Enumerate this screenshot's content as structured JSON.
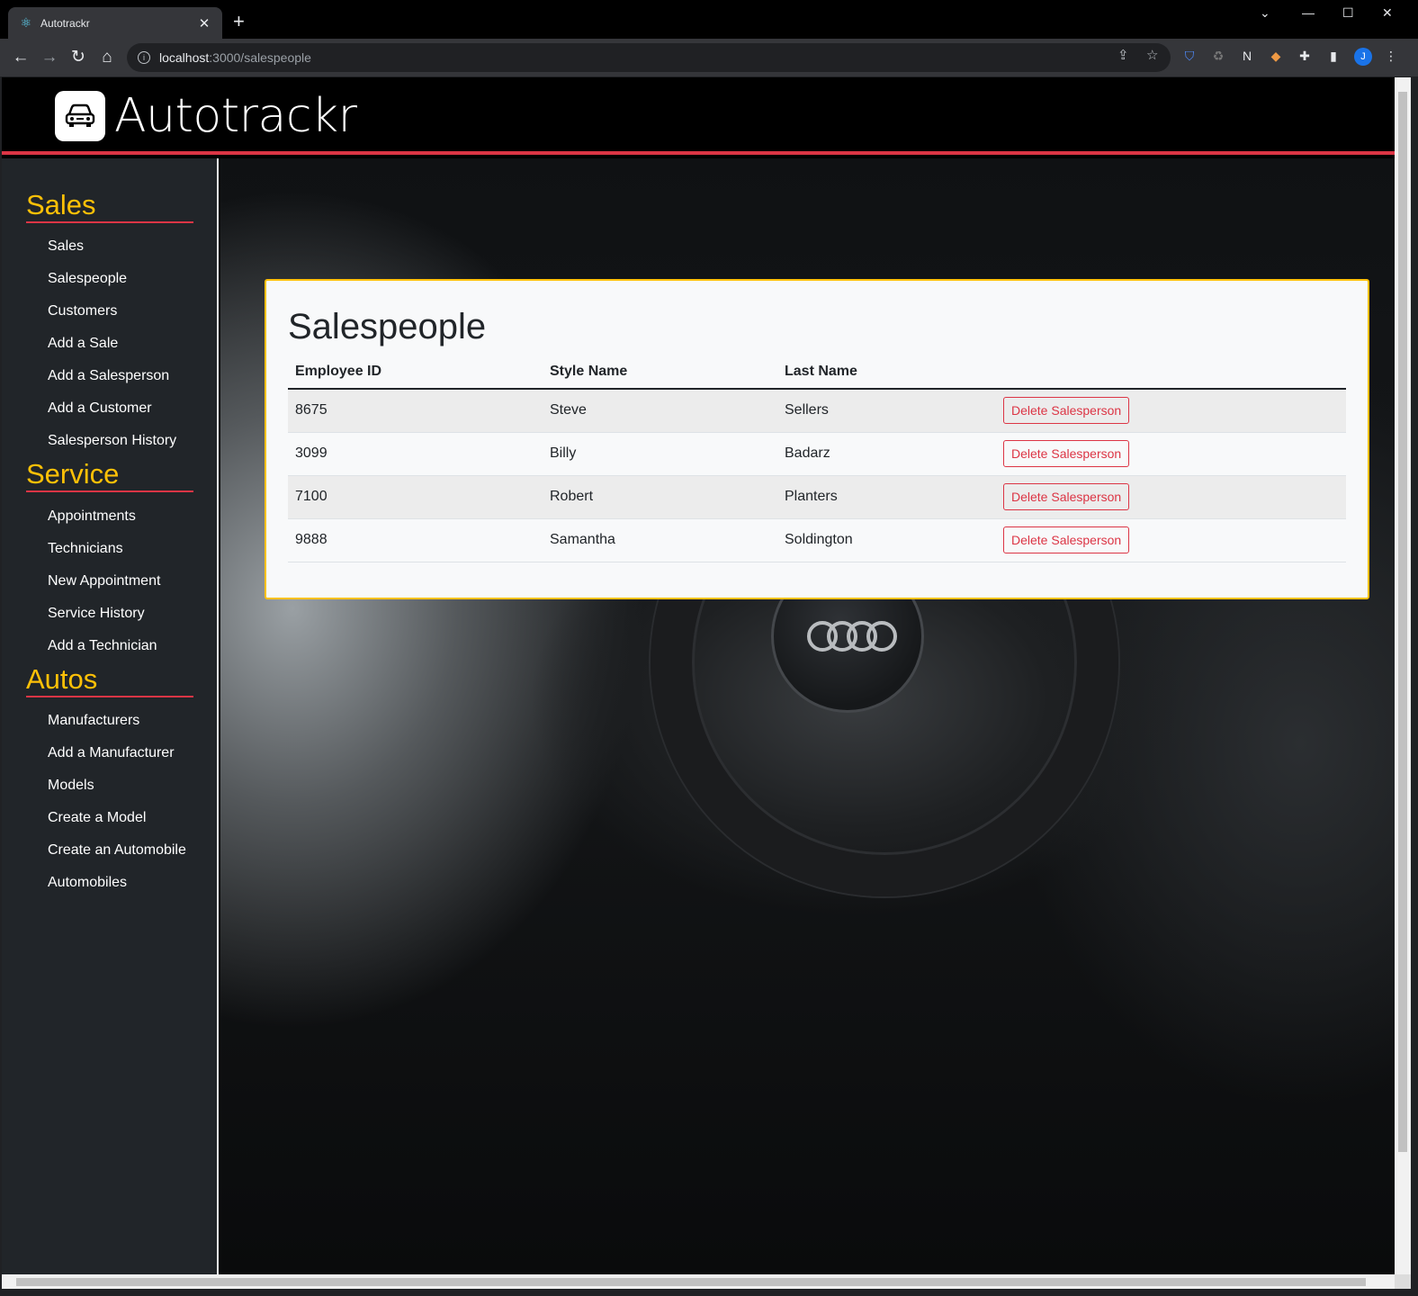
{
  "browser": {
    "tab_title": "Autotrackr",
    "url_host": "localhost",
    "url_rest": ":3000/salespeople",
    "avatar_initial": "J"
  },
  "brand": {
    "name": "Autotrackr"
  },
  "sidebar": {
    "sections": [
      {
        "title": "Sales",
        "items": [
          "Sales",
          "Salespeople",
          "Customers",
          "Add a Sale",
          "Add a Salesperson",
          "Add a Customer",
          "Salesperson History"
        ]
      },
      {
        "title": "Service",
        "items": [
          "Appointments",
          "Technicians",
          "New Appointment",
          "Service History",
          "Add a Technician"
        ]
      },
      {
        "title": "Autos",
        "items": [
          "Manufacturers",
          "Add a Manufacturer",
          "Models",
          "Create a Model",
          "Create an Automobile",
          "Automobiles"
        ]
      }
    ]
  },
  "main": {
    "title": "Salespeople",
    "columns": [
      "Employee ID",
      "Style Name",
      "Last Name"
    ],
    "rows": [
      {
        "id": "8675",
        "first": "Steve",
        "last": "Sellers",
        "action": "Delete Salesperson"
      },
      {
        "id": "3099",
        "first": "Billy",
        "last": "Badarz",
        "action": "Delete Salesperson"
      },
      {
        "id": "7100",
        "first": "Robert",
        "last": "Planters",
        "action": "Delete Salesperson"
      },
      {
        "id": "9888",
        "first": "Samantha",
        "last": "Soldington",
        "action": "Delete Salesperson"
      }
    ]
  },
  "colors": {
    "accent_yellow": "#ffc107",
    "accent_red": "#dc3545",
    "sidebar_bg": "#212529"
  }
}
